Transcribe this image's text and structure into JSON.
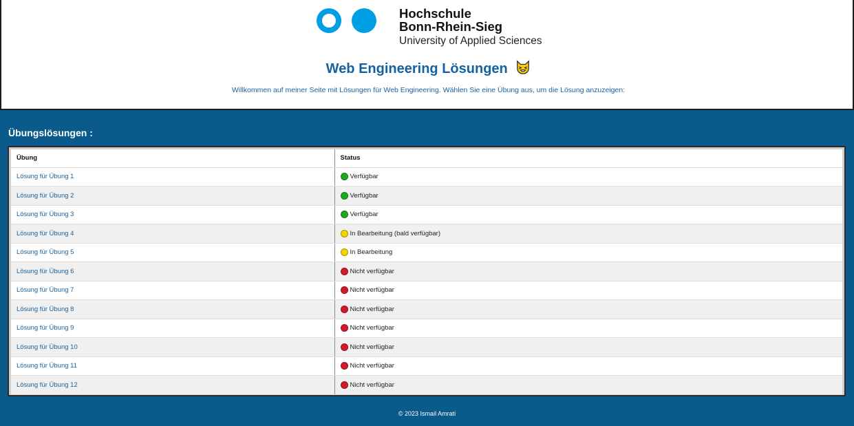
{
  "header": {
    "logo_line1": "Hochschule",
    "logo_line2": "Bonn-Rhein-Sieg",
    "logo_line3": "University of Applied Sciences",
    "title": "Web Engineering Lösungen",
    "title_emoji": "cat-face-icon",
    "subtitle": "Willkommen auf meiner Seite mit Lösungen für Web Engineering. Wählen Sie eine Übung aus, um die Lösung anzuzeigen:"
  },
  "section": {
    "title": "Übungslösungen :"
  },
  "table": {
    "columns": [
      "Übung",
      "Status"
    ],
    "rows": [
      {
        "link": "Lösung für Übung 1",
        "status": "Verfügbar",
        "color": "#1faa1f"
      },
      {
        "link": "Lösung für Übung 2",
        "status": "Verfügbar",
        "color": "#1faa1f"
      },
      {
        "link": "Lösung für Übung 3",
        "status": "Verfügbar",
        "color": "#1faa1f"
      },
      {
        "link": "Lösung für Übung 4",
        "status": "In Bearbeitung (bald verfügbar)",
        "color": "#f2d500"
      },
      {
        "link": "Lösung für Übung 5",
        "status": "In Bearbeitung",
        "color": "#f2d500"
      },
      {
        "link": "Lösung für Übung 6",
        "status": "Nicht verfügbar",
        "color": "#d11a2a"
      },
      {
        "link": "Lösung für Übung 7",
        "status": "Nicht verfügbar",
        "color": "#d11a2a"
      },
      {
        "link": "Lösung für Übung 8",
        "status": "Nicht verfügbar",
        "color": "#d11a2a"
      },
      {
        "link": "Lösung für Übung 9",
        "status": "Nicht verfügbar",
        "color": "#d11a2a"
      },
      {
        "link": "Lösung für Übung 10",
        "status": "Nicht verfügbar",
        "color": "#d11a2a"
      },
      {
        "link": "Lösung für Übung 11",
        "status": "Nicht verfügbar",
        "color": "#d11a2a"
      },
      {
        "link": "Lösung für Übung 12",
        "status": "Nicht verfügbar",
        "color": "#d11a2a"
      }
    ]
  },
  "footer": {
    "copyright": "© 2023 Ismail Amrati"
  },
  "colors": {
    "brand_blue": "#009fe3",
    "page_background": "#0a5a8c",
    "title_color": "#1560a0"
  }
}
